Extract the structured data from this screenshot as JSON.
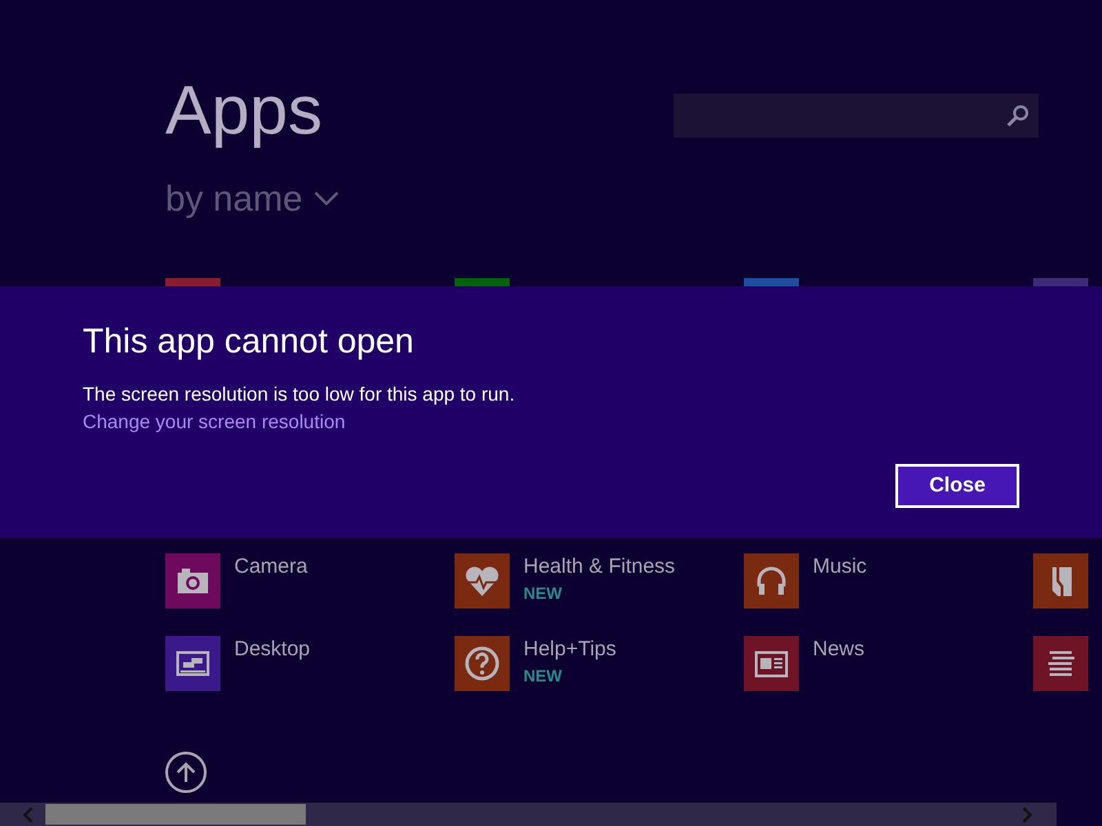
{
  "header": {
    "title": "Apps",
    "sort": "by name"
  },
  "apps": [
    {
      "kind": "red-tile",
      "color": "#8a1c30"
    },
    {
      "kind": "green-tile",
      "color": "#00640a"
    },
    {
      "kind": "blue-tile",
      "color": "#1e4ea0"
    },
    {
      "kind": "purple-tile",
      "color": "#3a2a78"
    },
    {
      "kind": "camera",
      "color": "#6e0a5e",
      "label": "Camera"
    },
    {
      "kind": "health",
      "color": "#7a2a10",
      "label": "Health & Fitness",
      "badge": "NEW"
    },
    {
      "kind": "music",
      "color": "#7a2a10",
      "label": "Music"
    },
    {
      "kind": "book",
      "color": "#7a2a10"
    },
    {
      "kind": "desktop",
      "color": "#3a1a8a",
      "label": "Desktop"
    },
    {
      "kind": "help",
      "color": "#7a2a10",
      "label": "Help+Tips",
      "badge": "NEW"
    },
    {
      "kind": "news",
      "color": "#6e1426",
      "label": "News"
    },
    {
      "kind": "reader",
      "color": "#6e1426"
    }
  ],
  "dialog": {
    "title": "This app cannot open",
    "message": "The screen resolution is too low for this app to run.",
    "link": "Change your screen resolution",
    "button": "Close"
  }
}
